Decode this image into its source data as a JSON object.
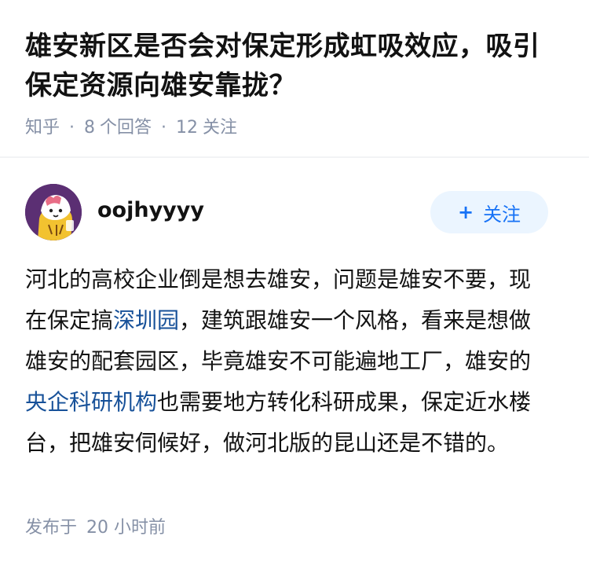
{
  "question": {
    "title": "雄安新区是否会对保定形成虹吸效应，吸引保定资源向雄安靠拢？",
    "source": "知乎",
    "answer_count": "8",
    "answer_label": "个回答",
    "follow_count": "12",
    "follow_label": "关注"
  },
  "author": {
    "name": "oojhyyyy",
    "follow_button": "关注",
    "follow_plus": "+"
  },
  "answer": {
    "segments": [
      {
        "text": "河北的高校企业倒是想去雄安，问题是雄安不要，现在保定搞",
        "link": false
      },
      {
        "text": "深圳园",
        "link": true
      },
      {
        "text": "，建筑跟雄安一个风格，看来是想做雄安的配套园区，毕竟雄安不可能遍地工厂，雄安的",
        "link": false
      },
      {
        "text": "央企科研机构",
        "link": true
      },
      {
        "text": "也需要地方转化科研成果，保定近水楼台，把雄安伺候好，做河北版的昆山还是不错的。",
        "link": false
      }
    ]
  },
  "footer": {
    "published_label": "发布于",
    "published_time": "20 小时前"
  },
  "colors": {
    "link": "#175199",
    "meta": "#8590a6",
    "follow_bg": "#ebf5ff",
    "follow_text": "#1772f6",
    "avatar_bg": "#5b2f73"
  }
}
